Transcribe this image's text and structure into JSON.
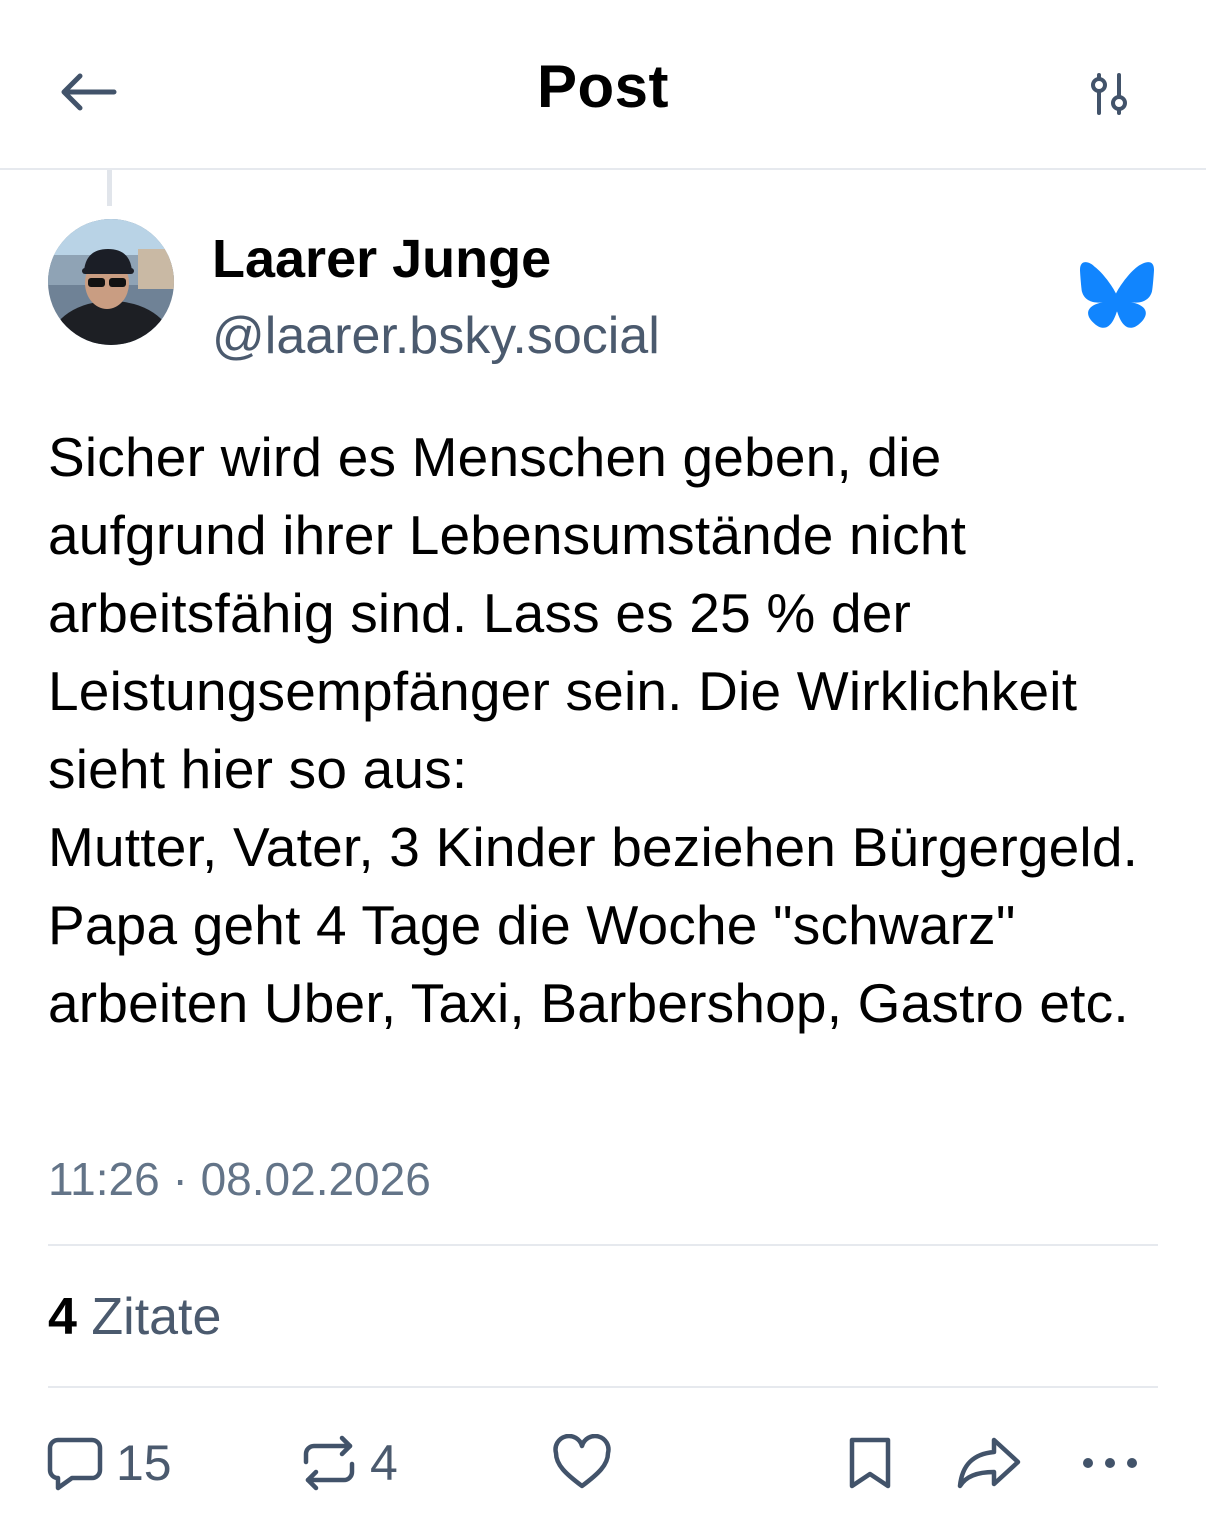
{
  "header": {
    "title": "Post",
    "back_icon": "arrow-left-icon",
    "filter_icon": "sliders-icon"
  },
  "post": {
    "author": {
      "display_name": "Laarer Junge",
      "handle": "@laarer.bsky.social",
      "avatar": "avatar"
    },
    "platform_icon": "bluesky-butterfly-icon",
    "brand_color": "#1185fe",
    "text": "Sicher wird es Menschen geben, die aufgrund ihrer Lebensumstände nicht arbeitsfähig sind. Lass es 25 % der Leistungsempfänger sein. Die Wirklichkeit sieht hier so aus:\nMutter, Vater, 3 Kinder beziehen Bürgergeld. Papa geht 4 Tage die Woche \"schwarz\" arbeiten Uber, Taxi, Barbershop, Gastro etc.",
    "timestamp": "11:26 · 08.02.2026"
  },
  "stats": {
    "quotes_count": "4",
    "quotes_label": "Zitate"
  },
  "actions": {
    "reply_count": "15",
    "repost_count": "4",
    "icons": [
      "reply-icon",
      "repost-icon",
      "like-icon",
      "bookmark-icon",
      "share-icon",
      "more-icon"
    ]
  }
}
